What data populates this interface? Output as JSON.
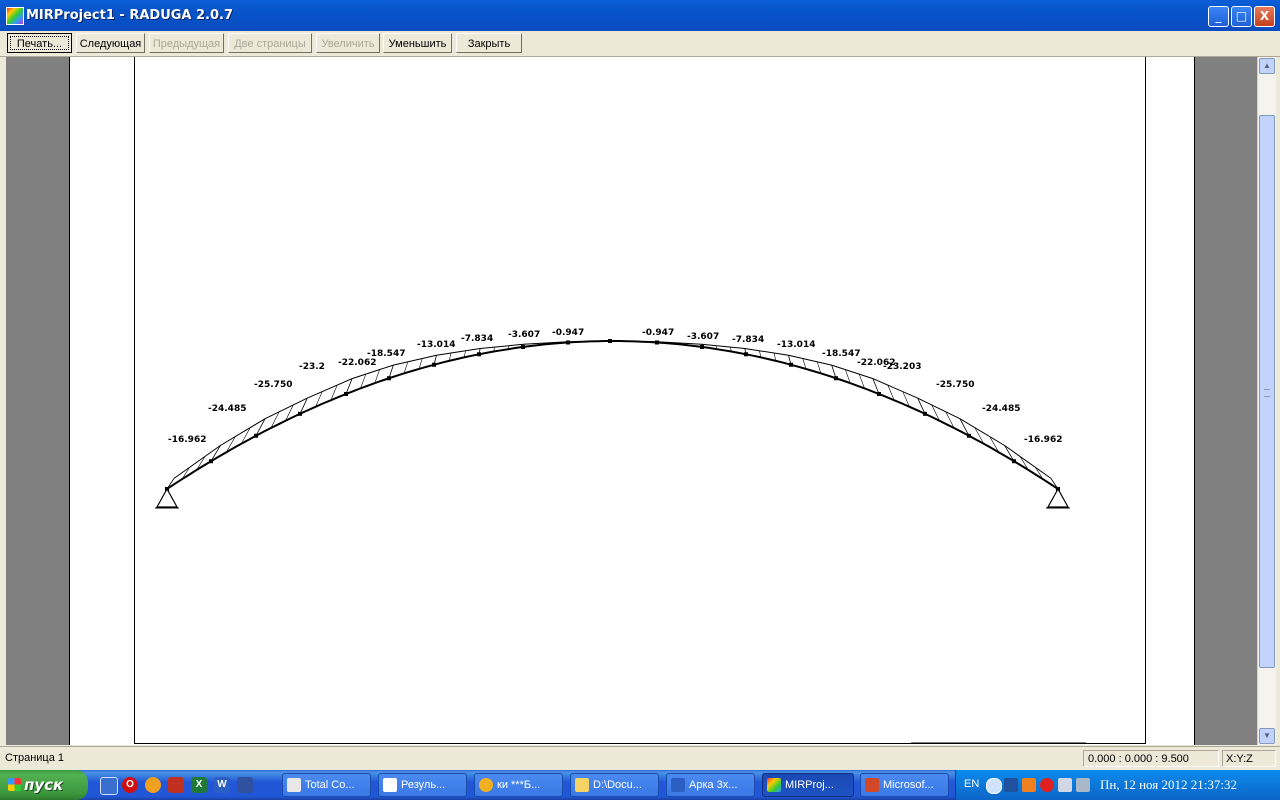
{
  "window": {
    "title": "MIRProject1 - RADUGA 2.0.7",
    "minimize_glyph": "_",
    "maximize_glyph": "□",
    "close_glyph": "X"
  },
  "toolbar": {
    "buttons": [
      {
        "label": "Печать...",
        "enabled": true,
        "focused": true
      },
      {
        "label": "Следующая",
        "enabled": true
      },
      {
        "label": "Предыдущая",
        "enabled": false
      },
      {
        "label": "Две страницы",
        "enabled": false
      },
      {
        "label": "Увеличить",
        "enabled": false
      },
      {
        "label": "Уменьшить",
        "enabled": true
      },
      {
        "label": "Закрыть",
        "enabled": true
      }
    ]
  },
  "drawing": {
    "moment_labels": [
      "-16.962",
      "-24.485",
      "-25.750",
      "-23.2",
      "-22.062",
      "-18.547",
      "-13.014",
      "-7.834",
      "-3.607",
      "-0.947",
      "-0.947",
      "-3.607",
      "-7.834",
      "-13.014",
      "-18.547",
      "-22.062",
      "-23.203",
      "-25.750",
      "-24.485",
      "-16.962"
    ]
  },
  "statusbar": {
    "page": "Страница 1",
    "coords": "0.000 : 0.000 : 9.500",
    "axes": "X:Y:Z"
  },
  "taskbar": {
    "start": "пуск",
    "tasks": [
      {
        "label": "Total Co...",
        "icon": "total-commander-icon",
        "color": "#e8e8e8"
      },
      {
        "label": "Резуль...",
        "icon": "document-icon",
        "color": "#ffffff"
      },
      {
        "label": "ки ***Б...",
        "icon": "archicad-icon",
        "color": "#f0b020"
      },
      {
        "label": "D:\\Docu...",
        "icon": "folder-icon",
        "color": "#f6d365"
      },
      {
        "label": "Арка 3х...",
        "icon": "word-icon",
        "color": "#2b5fc4"
      },
      {
        "label": "MIRProj...",
        "icon": "raduga-icon",
        "color": "#e33",
        "active": true
      },
      {
        "label": "Microsof...",
        "icon": "powerpoint-icon",
        "color": "#d24726"
      }
    ],
    "tray": {
      "lang": "EN",
      "clock": "Пн, 12 ноя 2012 21:37:32"
    }
  }
}
